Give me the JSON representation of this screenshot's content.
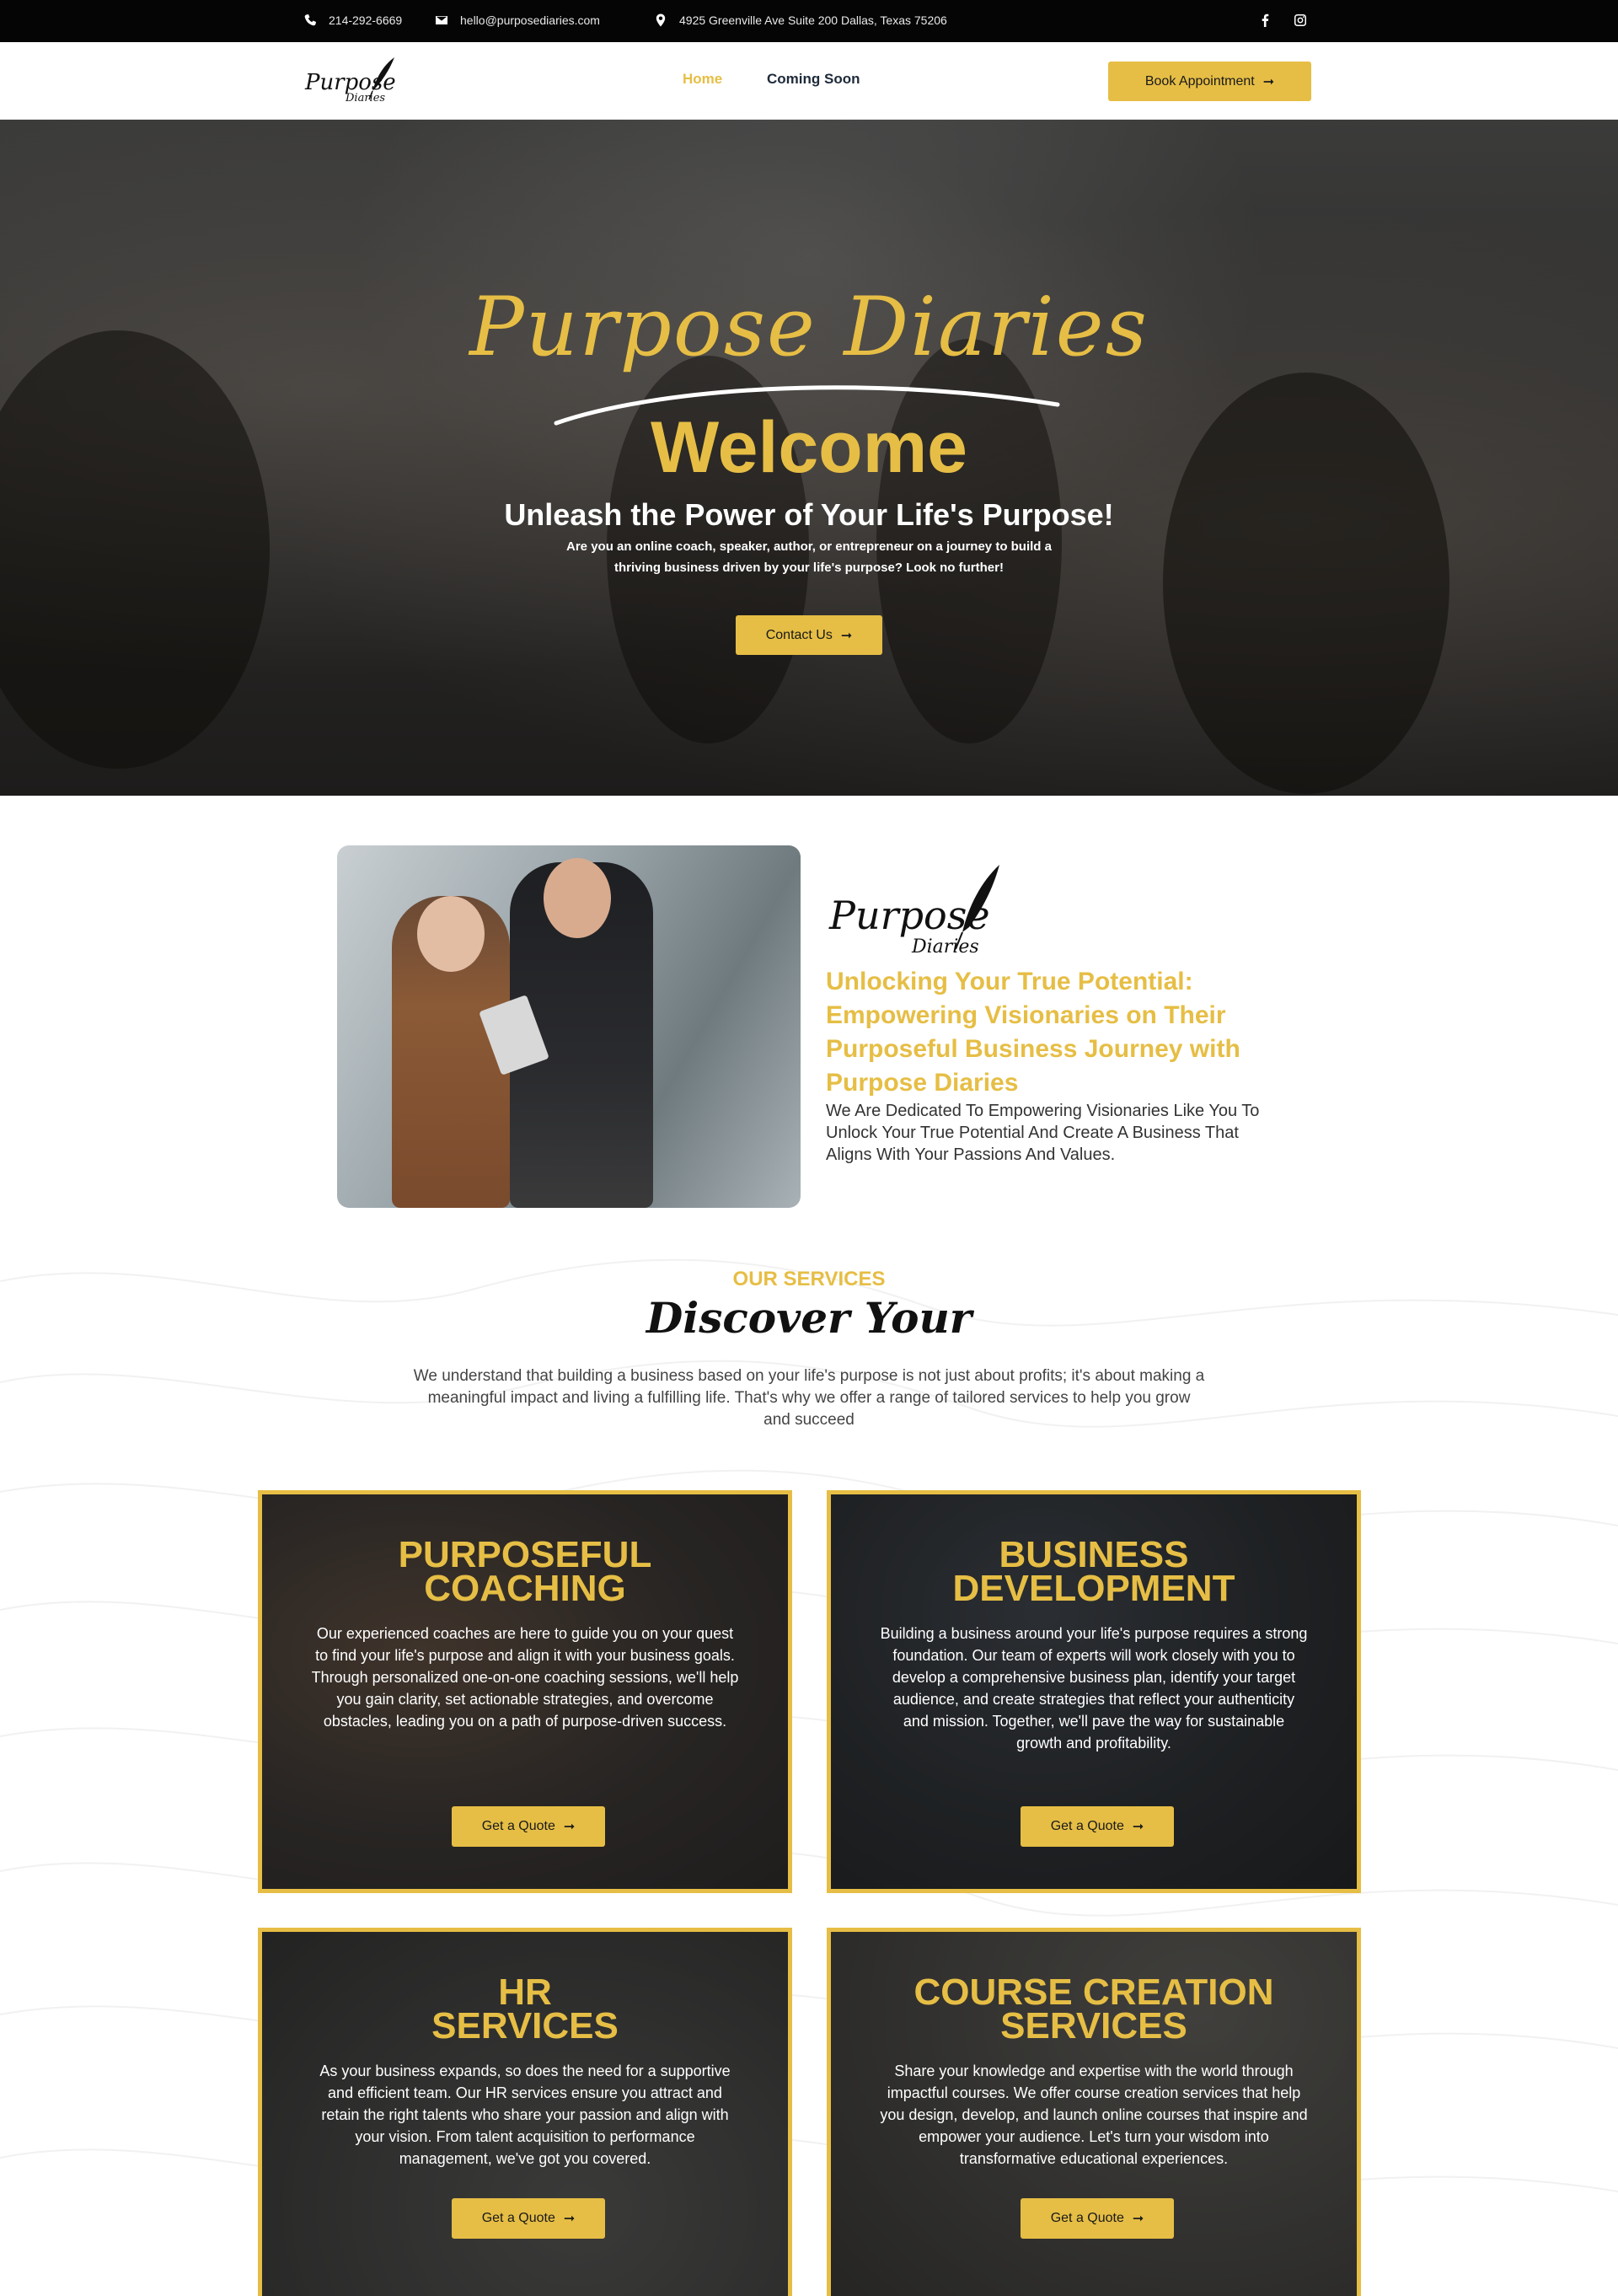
{
  "topbar": {
    "phone": "214-292-6669",
    "email": "hello@purposediaries.com",
    "address": "4925 Greenville Ave Suite 200 Dallas, Texas 75206",
    "social": [
      "facebook-icon",
      "instagram-icon"
    ]
  },
  "header": {
    "logo_text": "Purpose Diaries",
    "nav": [
      {
        "label": "Home",
        "active": true
      },
      {
        "label": "Coming Soon",
        "active": false
      }
    ],
    "cta_label": "Book Appointment"
  },
  "hero": {
    "script_title": "Purpose Diaries",
    "welcome": "Welcome",
    "tagline": "Unleash the Power of Your Life's Purpose!",
    "subtitle": "Are you an online coach, speaker, author, or entrepreneur on a journey to build a thriving business driven by your life's purpose? Look no further!",
    "cta_label": "Contact Us"
  },
  "about": {
    "logo_text": "Purpose Diaries",
    "heading": "Unlocking Your True Potential: Empowering Visionaries on Their Purposeful Business Journey with Purpose Diaries",
    "text": "We Are Dedicated To Empowering Visionaries Like You To Unlock Your True Potential And Create A Business That Aligns With Your Passions And Values."
  },
  "services": {
    "label": "OUR SERVICES",
    "title": "Discover Your",
    "intro": "We understand that building a business based on your life's purpose is not just about profits; it's about making a meaningful impact and living a fulfilling life. That's why we offer a range of tailored services to help you grow and succeed",
    "cards": [
      {
        "title_line1": "PURPOSEFUL",
        "title_line2": "COACHING",
        "description": "Our experienced coaches are here to guide you on your quest to find your life's purpose and align it with your business goals. Through personalized one-on-one coaching sessions, we'll help you gain clarity, set actionable strategies, and overcome obstacles, leading you on a path of purpose-driven success.",
        "cta_label": "Get a Quote"
      },
      {
        "title_line1": "BUSINESS",
        "title_line2": "DEVELOPMENT",
        "description": "Building a business around your life's purpose requires a strong foundation. Our team of experts will work closely with you to develop a comprehensive business plan, identify your target audience, and create strategies that reflect your authenticity and mission. Together, we'll pave the way for sustainable growth and profitability.",
        "cta_label": "Get a Quote"
      },
      {
        "title_line1": "HR",
        "title_line2": "SERVICES",
        "description": "As your business expands, so does the need for a supportive and efficient team. Our HR services ensure you attract and retain the right talents who share your passion and align with your vision. From talent acquisition to performance management, we've got you covered.",
        "cta_label": "Get a Quote"
      },
      {
        "title_line1": "COURSE CREATION",
        "title_line2": "SERVICES",
        "description": "Share your knowledge and expertise with the world through impactful courses. We offer course creation services that help you design, develop, and launch online courses that inspire and empower your audience. Let's turn your wisdom into transformative educational experiences.",
        "cta_label": "Get a Quote"
      }
    ]
  },
  "colors": {
    "accent": "#e6be45",
    "topbar": "#050505",
    "nav_active": "#e6be45",
    "nav_default": "#1e2a3a"
  }
}
